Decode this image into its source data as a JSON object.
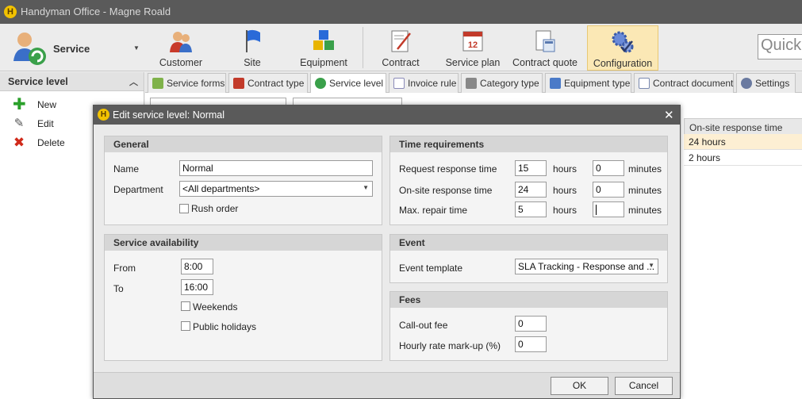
{
  "app": {
    "title": "Handyman Office - Magne Roald",
    "logo_letter": "H"
  },
  "ribbon": {
    "module_label": "Service",
    "buttons": [
      {
        "label": "Customer",
        "icon": "customer-icon"
      },
      {
        "label": "Site",
        "icon": "flag-icon"
      },
      {
        "label": "Equipment",
        "icon": "equipment-cubes-icon"
      },
      {
        "label": "Contract",
        "icon": "contract-icon"
      },
      {
        "label": "Service plan",
        "icon": "calendar-icon"
      },
      {
        "label": "Contract quote",
        "icon": "calculator-icon"
      },
      {
        "label": "Configuration",
        "icon": "gears-icon",
        "active": true
      }
    ],
    "quick_search": "Quick"
  },
  "left_panel": {
    "header": "Service level",
    "items": [
      {
        "label": "New",
        "icon": "plus-icon"
      },
      {
        "label": "Edit",
        "icon": "edit-icon"
      },
      {
        "label": "Delete",
        "icon": "delete-icon"
      }
    ]
  },
  "tabs": [
    {
      "label": "Service forms",
      "color": "#7fb24a"
    },
    {
      "label": "Contract type",
      "color": "#c23a2a"
    },
    {
      "label": "Service level",
      "color": "#3aa04a",
      "active": true
    },
    {
      "label": "Invoice rule",
      "color": "#8a8ab8"
    },
    {
      "label": "Category type",
      "color": "#777777"
    },
    {
      "label": "Equipment type",
      "color": "#4a7ac8"
    },
    {
      "label": "Contract document",
      "color": "#7a8ab0"
    },
    {
      "label": "Settings",
      "color": "#6a7aa0"
    }
  ],
  "grid": {
    "column_header": "On-site response time",
    "rows": [
      "24 hours",
      "2 hours"
    ]
  },
  "dialog": {
    "title": "Edit service level: Normal",
    "close_glyph": "✕",
    "general": {
      "header": "General",
      "name_label": "Name",
      "name_value": "Normal",
      "department_label": "Department",
      "department_value": "<All departments>",
      "rush_order_label": "Rush order"
    },
    "availability": {
      "header": "Service availability",
      "from_label": "From",
      "from_value": "8:00",
      "to_label": "To",
      "to_value": "16:00",
      "weekends_label": "Weekends",
      "holidays_label": "Public holidays"
    },
    "time": {
      "header": "Time requirements",
      "rows": [
        {
          "label": "Request response time",
          "hours": "15",
          "minutes": "0"
        },
        {
          "label": "On-site response time",
          "hours": "24",
          "minutes": "0"
        },
        {
          "label": "Max. repair time",
          "hours": "5",
          "minutes": ""
        }
      ],
      "hours_unit": "hours",
      "minutes_unit": "minutes"
    },
    "event": {
      "header": "Event",
      "template_label": "Event template",
      "template_value": "SLA Tracking - Response and ..."
    },
    "fees": {
      "header": "Fees",
      "callout_label": "Call-out fee",
      "callout_value": "0",
      "markup_label": "Hourly rate mark-up (%)",
      "markup_value": "0"
    },
    "ok_label": "OK",
    "cancel_label": "Cancel"
  }
}
